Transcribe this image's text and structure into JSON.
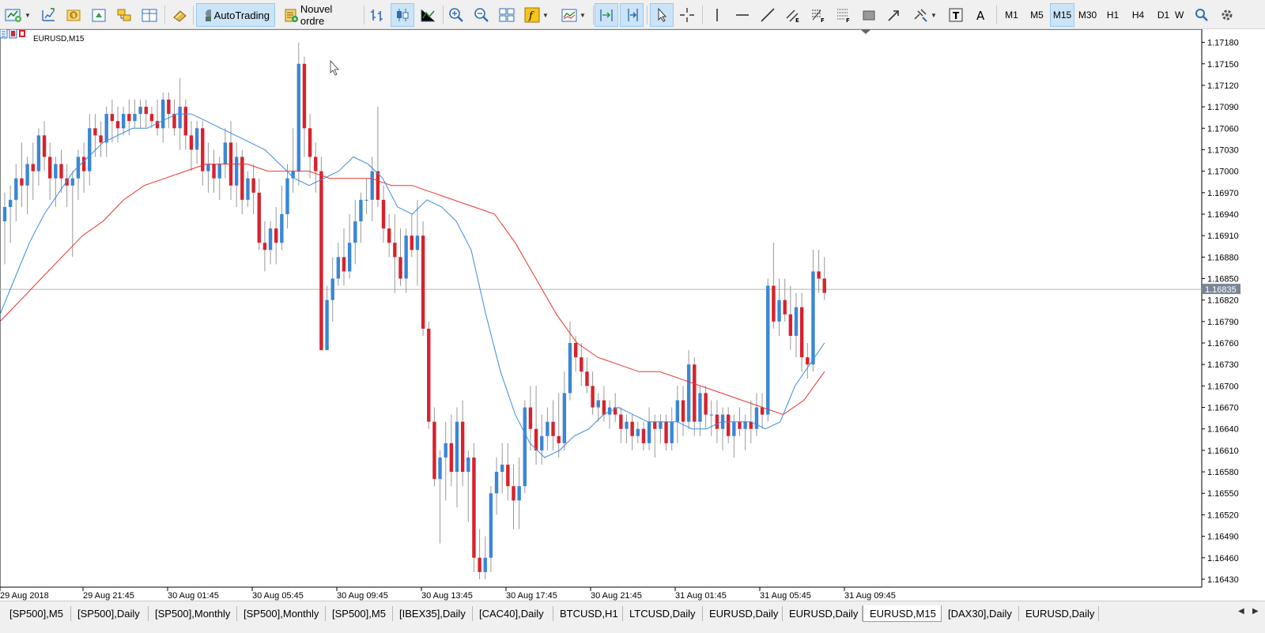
{
  "toolbar": {
    "autotrading_label": "AutoTrading",
    "new_order_label": "Nouvel ordre",
    "timeframes": [
      "M1",
      "M5",
      "M15",
      "M30",
      "H1",
      "H4",
      "D1",
      "W"
    ],
    "active_timeframe": "M15"
  },
  "chart": {
    "title": "EURUSD,M15",
    "current_price": "1.16835",
    "price_axis": [
      "1.17180",
      "1.17150",
      "1.17120",
      "1.17090",
      "1.17060",
      "1.17030",
      "1.17000",
      "1.16970",
      "1.16940",
      "1.16910",
      "1.16880",
      "1.16850",
      "1.16820",
      "1.16790",
      "1.16760",
      "1.16730",
      "1.16700",
      "1.16670",
      "1.16640",
      "1.16610",
      "1.16580",
      "1.16550",
      "1.16520",
      "1.16490",
      "1.16460",
      "1.16430"
    ],
    "time_axis": [
      "29 Aug 2018",
      "29 Aug 21:45",
      "30 Aug 01:45",
      "30 Aug 05:45",
      "30 Aug 09:45",
      "30 Aug 13:45",
      "30 Aug 17:45",
      "30 Aug 21:45",
      "31 Aug 01:45",
      "31 Aug 05:45",
      "31 Aug 09:45"
    ],
    "colors": {
      "bull": "#3a87d6",
      "bear": "#d8222c",
      "ma_fast": "#3a8de0",
      "ma_slow": "#e8332e",
      "price_line": "#b4b4b4",
      "price_tag_bg": "#7a8596"
    }
  },
  "chart_data": {
    "type": "candlestick",
    "symbol": "EURUSD",
    "timeframe": "M15",
    "ylim": [
      1.1642,
      1.17195
    ],
    "current_price": 1.16835,
    "x_tick_labels": [
      "29 Aug 2018",
      "29 Aug 21:45",
      "30 Aug 01:45",
      "30 Aug 05:45",
      "30 Aug 09:45",
      "30 Aug 13:45",
      "30 Aug 17:45",
      "30 Aug 21:45",
      "31 Aug 01:45",
      "31 Aug 05:45",
      "31 Aug 09:45"
    ],
    "candles": [
      [
        1.1693,
        1.1697,
        1.1687,
        1.1695
      ],
      [
        1.1695,
        1.1698,
        1.169,
        1.1696
      ],
      [
        1.1696,
        1.1701,
        1.1693,
        1.1699
      ],
      [
        1.1699,
        1.1704,
        1.1695,
        1.1698
      ],
      [
        1.1698,
        1.1702,
        1.1694,
        1.1701
      ],
      [
        1.1701,
        1.1704,
        1.1696,
        1.17
      ],
      [
        1.17,
        1.1706,
        1.1698,
        1.1705
      ],
      [
        1.1705,
        1.1707,
        1.17,
        1.1702
      ],
      [
        1.1702,
        1.1704,
        1.1696,
        1.1699
      ],
      [
        1.1699,
        1.1702,
        1.1695,
        1.1701
      ],
      [
        1.1701,
        1.1703,
        1.1697,
        1.1699
      ],
      [
        1.1699,
        1.1701,
        1.1695,
        1.1698
      ],
      [
        1.1698,
        1.17,
        1.1688,
        1.1699
      ],
      [
        1.1699,
        1.1703,
        1.1696,
        1.1702
      ],
      [
        1.1702,
        1.1704,
        1.1697,
        1.17
      ],
      [
        1.17,
        1.1708,
        1.1698,
        1.1706
      ],
      [
        1.1706,
        1.1708,
        1.1702,
        1.1705
      ],
      [
        1.1705,
        1.1707,
        1.1702,
        1.1704
      ],
      [
        1.1704,
        1.1709,
        1.1702,
        1.1708
      ],
      [
        1.1708,
        1.171,
        1.1704,
        1.1707
      ],
      [
        1.1707,
        1.1709,
        1.1704,
        1.1706
      ],
      [
        1.1706,
        1.1709,
        1.1705,
        1.1708
      ],
      [
        1.1708,
        1.171,
        1.1705,
        1.1707
      ],
      [
        1.1707,
        1.171,
        1.1706,
        1.1708
      ],
      [
        1.1708,
        1.171,
        1.1706,
        1.1709
      ],
      [
        1.1709,
        1.171,
        1.1706,
        1.1708
      ],
      [
        1.1708,
        1.1709,
        1.1706,
        1.1707
      ],
      [
        1.1707,
        1.171,
        1.1705,
        1.1706
      ],
      [
        1.1706,
        1.1711,
        1.1704,
        1.171
      ],
      [
        1.171,
        1.1711,
        1.1706,
        1.1708
      ],
      [
        1.1708,
        1.171,
        1.1705,
        1.1706
      ],
      [
        1.1706,
        1.1713,
        1.1703,
        1.1709
      ],
      [
        1.1709,
        1.171,
        1.1703,
        1.1705
      ],
      [
        1.1705,
        1.1707,
        1.17,
        1.1703
      ],
      [
        1.1703,
        1.1707,
        1.1701,
        1.1706
      ],
      [
        1.1706,
        1.1707,
        1.1698,
        1.17
      ],
      [
        1.17,
        1.1704,
        1.1697,
        1.1701
      ],
      [
        1.1701,
        1.1703,
        1.1697,
        1.1699
      ],
      [
        1.1699,
        1.1702,
        1.1696,
        1.1701
      ],
      [
        1.1701,
        1.1706,
        1.1699,
        1.1704
      ],
      [
        1.1704,
        1.1707,
        1.1696,
        1.1698
      ],
      [
        1.1698,
        1.1704,
        1.1695,
        1.1702
      ],
      [
        1.1702,
        1.1703,
        1.1694,
        1.1696
      ],
      [
        1.1696,
        1.17,
        1.1695,
        1.1699
      ],
      [
        1.1699,
        1.1701,
        1.1694,
        1.1697
      ],
      [
        1.1697,
        1.1699,
        1.1689,
        1.169
      ],
      [
        1.169,
        1.1693,
        1.1686,
        1.1689
      ],
      [
        1.1689,
        1.1693,
        1.1687,
        1.1692
      ],
      [
        1.1692,
        1.1695,
        1.1687,
        1.169
      ],
      [
        1.169,
        1.1698,
        1.1689,
        1.1694
      ],
      [
        1.1694,
        1.1701,
        1.1692,
        1.1699
      ],
      [
        1.1699,
        1.1706,
        1.1697,
        1.17
      ],
      [
        1.17,
        1.1718,
        1.1698,
        1.1715
      ],
      [
        1.1715,
        1.1716,
        1.1702,
        1.1706
      ],
      [
        1.1706,
        1.1708,
        1.1699,
        1.1702
      ],
      [
        1.1702,
        1.1704,
        1.1697,
        1.17
      ],
      [
        1.17,
        1.1702,
        1.1675,
        1.1675
      ],
      [
        1.1675,
        1.1684,
        1.1675,
        1.1682
      ],
      [
        1.1682,
        1.1688,
        1.1679,
        1.1685
      ],
      [
        1.1685,
        1.169,
        1.1684,
        1.1688
      ],
      [
        1.1688,
        1.1692,
        1.1684,
        1.1686
      ],
      [
        1.1686,
        1.1694,
        1.1685,
        1.169
      ],
      [
        1.169,
        1.1696,
        1.1687,
        1.1693
      ],
      [
        1.1693,
        1.1697,
        1.169,
        1.1696
      ],
      [
        1.1696,
        1.1699,
        1.1694,
        1.1696
      ],
      [
        1.1696,
        1.1702,
        1.1693,
        1.17
      ],
      [
        1.17,
        1.1709,
        1.1695,
        1.1696
      ],
      [
        1.1696,
        1.1698,
        1.169,
        1.1692
      ],
      [
        1.1692,
        1.1694,
        1.1688,
        1.169
      ],
      [
        1.169,
        1.1694,
        1.1683,
        1.1688
      ],
      [
        1.1688,
        1.1692,
        1.1684,
        1.1685
      ],
      [
        1.1685,
        1.1692,
        1.1683,
        1.1691
      ],
      [
        1.1691,
        1.1694,
        1.1688,
        1.1689
      ],
      [
        1.1689,
        1.1696,
        1.1684,
        1.1691
      ],
      [
        1.1691,
        1.1693,
        1.1677,
        1.1678
      ],
      [
        1.1678,
        1.1679,
        1.1664,
        1.1665
      ],
      [
        1.1665,
        1.1667,
        1.1656,
        1.1657
      ],
      [
        1.1657,
        1.1661,
        1.1648,
        1.166
      ],
      [
        1.166,
        1.1665,
        1.1654,
        1.1662
      ],
      [
        1.1662,
        1.1666,
        1.1656,
        1.1658
      ],
      [
        1.1658,
        1.1667,
        1.1653,
        1.1665
      ],
      [
        1.1665,
        1.1668,
        1.1656,
        1.1658
      ],
      [
        1.1658,
        1.1661,
        1.1651,
        1.166
      ],
      [
        1.166,
        1.1662,
        1.1644,
        1.1646
      ],
      [
        1.1646,
        1.165,
        1.1643,
        1.1644
      ],
      [
        1.1644,
        1.1649,
        1.1643,
        1.1646
      ],
      [
        1.1646,
        1.1656,
        1.1644,
        1.1655
      ],
      [
        1.1655,
        1.166,
        1.1652,
        1.1658
      ],
      [
        1.1658,
        1.1662,
        1.1655,
        1.1659
      ],
      [
        1.1659,
        1.1662,
        1.1654,
        1.1656
      ],
      [
        1.1656,
        1.1659,
        1.165,
        1.1654
      ],
      [
        1.1654,
        1.166,
        1.165,
        1.1656
      ],
      [
        1.1656,
        1.1668,
        1.1655,
        1.1667
      ],
      [
        1.1667,
        1.167,
        1.1661,
        1.1664
      ],
      [
        1.1664,
        1.167,
        1.1659,
        1.1661
      ],
      [
        1.1661,
        1.1666,
        1.1659,
        1.1663
      ],
      [
        1.1663,
        1.1667,
        1.1661,
        1.1665
      ],
      [
        1.1665,
        1.1668,
        1.1661,
        1.1663
      ],
      [
        1.1663,
        1.1669,
        1.166,
        1.1662
      ],
      [
        1.1662,
        1.1672,
        1.1661,
        1.1669
      ],
      [
        1.1669,
        1.1679,
        1.1668,
        1.1676
      ],
      [
        1.1676,
        1.1677,
        1.1672,
        1.1674
      ],
      [
        1.1674,
        1.1676,
        1.167,
        1.1672
      ],
      [
        1.1672,
        1.1674,
        1.1669,
        1.167
      ],
      [
        1.167,
        1.1672,
        1.1666,
        1.1667
      ],
      [
        1.1667,
        1.1669,
        1.1665,
        1.1668
      ],
      [
        1.1668,
        1.167,
        1.1665,
        1.1666
      ],
      [
        1.1666,
        1.1668,
        1.1664,
        1.1667
      ],
      [
        1.1667,
        1.1669,
        1.1665,
        1.1666
      ],
      [
        1.1666,
        1.1667,
        1.1662,
        1.1664
      ],
      [
        1.1664,
        1.1666,
        1.1662,
        1.1665
      ],
      [
        1.1665,
        1.1666,
        1.1661,
        1.1663
      ],
      [
        1.1663,
        1.1665,
        1.1662,
        1.1664
      ],
      [
        1.1664,
        1.1665,
        1.1661,
        1.1662
      ],
      [
        1.1662,
        1.1667,
        1.1661,
        1.1665
      ],
      [
        1.1665,
        1.1666,
        1.166,
        1.1664
      ],
      [
        1.1664,
        1.1666,
        1.1662,
        1.1665
      ],
      [
        1.1665,
        1.1666,
        1.1661,
        1.1662
      ],
      [
        1.1662,
        1.1667,
        1.1661,
        1.1665
      ],
      [
        1.1665,
        1.167,
        1.1662,
        1.1668
      ],
      [
        1.1668,
        1.167,
        1.1663,
        1.1665
      ],
      [
        1.1665,
        1.1675,
        1.1664,
        1.1673
      ],
      [
        1.1673,
        1.1674,
        1.1663,
        1.1665
      ],
      [
        1.1665,
        1.167,
        1.1663,
        1.1669
      ],
      [
        1.1669,
        1.167,
        1.1664,
        1.1666
      ],
      [
        1.1666,
        1.1668,
        1.1663,
        1.1666
      ],
      [
        1.1666,
        1.1668,
        1.1662,
        1.1664
      ],
      [
        1.1664,
        1.1667,
        1.1661,
        1.1666
      ],
      [
        1.1666,
        1.1667,
        1.1662,
        1.1663
      ],
      [
        1.1663,
        1.1666,
        1.166,
        1.1665
      ],
      [
        1.1665,
        1.1667,
        1.1663,
        1.1664
      ],
      [
        1.1664,
        1.1666,
        1.1661,
        1.1665
      ],
      [
        1.1665,
        1.1668,
        1.1662,
        1.1664
      ],
      [
        1.1664,
        1.1669,
        1.1663,
        1.1667
      ],
      [
        1.1667,
        1.1669,
        1.1664,
        1.1666
      ],
      [
        1.1666,
        1.1685,
        1.1665,
        1.1684
      ],
      [
        1.1684,
        1.169,
        1.1678,
        1.1679
      ],
      [
        1.1679,
        1.1685,
        1.1677,
        1.1682
      ],
      [
        1.1682,
        1.1685,
        1.1679,
        1.168
      ],
      [
        1.168,
        1.1684,
        1.1675,
        1.1677
      ],
      [
        1.1677,
        1.1683,
        1.1674,
        1.1681
      ],
      [
        1.1681,
        1.1683,
        1.1672,
        1.1674
      ],
      [
        1.1674,
        1.1676,
        1.1671,
        1.1673
      ],
      [
        1.1673,
        1.1689,
        1.1672,
        1.1686
      ],
      [
        1.1686,
        1.1689,
        1.1683,
        1.1685
      ],
      [
        1.1685,
        1.1688,
        1.1682,
        1.1683
      ]
    ],
    "ma_fast": [
      1.168,
      1.1685,
      1.169,
      1.1694,
      1.1697,
      1.17,
      1.1702,
      1.1704,
      1.1705,
      1.1706,
      1.1706,
      1.1707,
      1.1708,
      1.1708,
      1.1707,
      1.1706,
      1.1705,
      1.1704,
      1.1703,
      1.1701,
      1.1699,
      1.1698,
      1.1699,
      1.17,
      1.1702,
      1.1701,
      1.1699,
      1.1695,
      1.1694,
      1.1696,
      1.1695,
      1.1693,
      1.1689,
      1.168,
      1.1672,
      1.1666,
      1.1662,
      1.166,
      1.1661,
      1.1663,
      1.1664,
      1.1666,
      1.1667,
      1.1666,
      1.1665,
      1.1665,
      1.1665,
      1.1664,
      1.1664,
      1.1665,
      1.1665,
      1.1665,
      1.1664,
      1.1665,
      1.167,
      1.1673,
      1.1676
    ],
    "ma_slow": [
      1.1679,
      1.1682,
      1.1685,
      1.1688,
      1.1691,
      1.1693,
      1.1696,
      1.1698,
      1.1699,
      1.17,
      1.1701,
      1.1701,
      1.1701,
      1.17,
      1.17,
      1.17,
      1.1699,
      1.1699,
      1.1699,
      1.1698,
      1.1698,
      1.1697,
      1.1696,
      1.1695,
      1.1694,
      1.169,
      1.1685,
      1.168,
      1.1676,
      1.1674,
      1.1673,
      1.1672,
      1.1672,
      1.1671,
      1.167,
      1.1669,
      1.1668,
      1.1667,
      1.1666,
      1.1668,
      1.1672
    ]
  },
  "tabs": [
    "[SP500],M5",
    "[SP500],Daily",
    "[SP500],Monthly",
    "[SP500],Monthly",
    "[SP500],M5",
    "[IBEX35],Daily",
    "[CAC40],Daily",
    "BTCUSD,H1",
    "LTCUSD,Daily",
    "EURUSD,Daily",
    "EURUSD,Daily",
    "EURUSD,M15",
    "[DAX30],Daily",
    "EURUSD,Daily"
  ],
  "active_tab_index": 11
}
